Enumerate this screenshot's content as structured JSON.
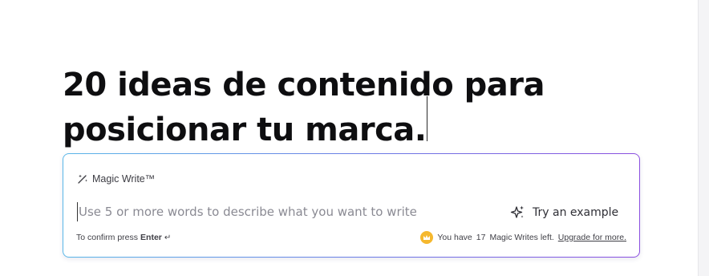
{
  "document": {
    "heading_line1": "20 ideas de contenido para",
    "heading_line2": "posicionar tu marca."
  },
  "magic_write": {
    "title": "Magic Write™",
    "prompt_placeholder": "Use 5 or more words to describe what you want to write",
    "prompt_value": "",
    "try_example_label": "Try an example",
    "confirm_prefix": "To confirm press",
    "confirm_key": "Enter",
    "credits_prefix": "You have",
    "credits_count": "17",
    "credits_suffix": "Magic Writes left.",
    "upgrade_label": "Upgrade for more."
  },
  "icons": {
    "wand": "magic-wand-icon",
    "sparkle": "sparkle-icon",
    "enter": "enter-key-icon",
    "crown": "crown-icon"
  },
  "colors": {
    "border_gradient_start": "#5ab7e8",
    "border_gradient_end": "#8b4fe0",
    "crown_badge": "#f5b82e",
    "heading_text": "#0e0e10"
  }
}
